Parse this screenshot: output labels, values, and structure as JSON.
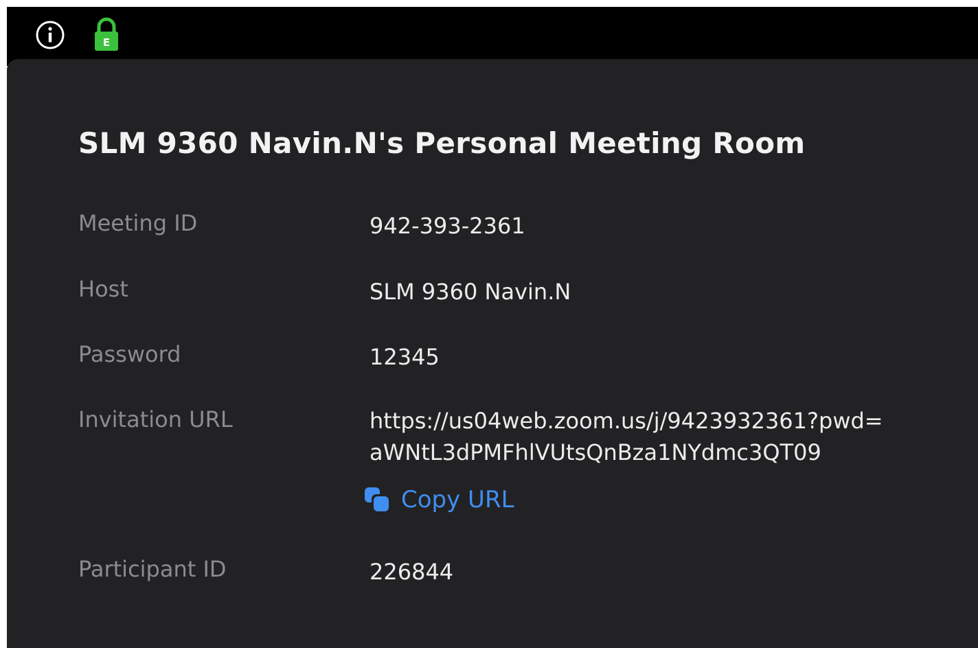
{
  "topbar": {
    "icons": [
      "info-icon",
      "encrypted-lock-icon"
    ],
    "lock_badge": "E",
    "lock_color": "#3cc13c"
  },
  "meeting": {
    "title": "SLM 9360 Navin.N's Personal Meeting Room",
    "rows": [
      {
        "label": "Meeting ID",
        "value": "942-393-2361"
      },
      {
        "label": "Host",
        "value": "SLM 9360 Navin.N"
      },
      {
        "label": "Password",
        "value": "12345"
      },
      {
        "label": "Invitation URL",
        "value_lines": [
          "https://us04web.zoom.us/j/9423932361?pwd=",
          "aWNtL3dPMFhlVUtsQnBza1NYdmc3QT09"
        ]
      },
      {
        "label": "Participant ID",
        "value": "226844"
      }
    ],
    "copy_url_label": "Copy URL",
    "copy_icon": "copy-icon",
    "accent_color": "#3f8ef0"
  }
}
